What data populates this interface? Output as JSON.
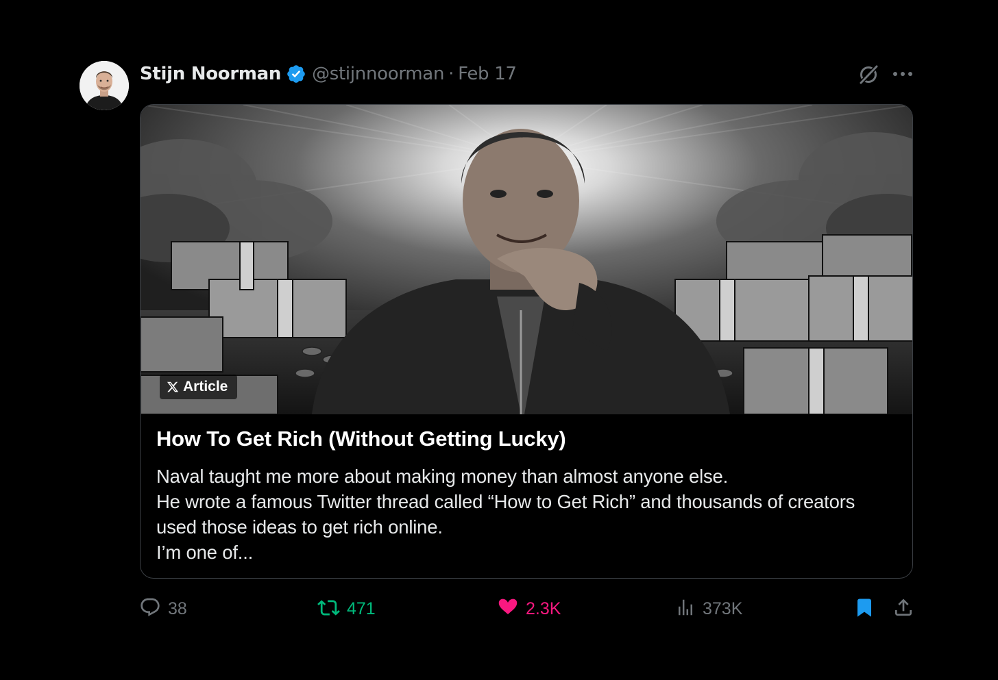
{
  "tweet": {
    "author": {
      "name": "Stijn Noorman",
      "handle": "@stijnnoorman",
      "verified": true,
      "verified_color": "#1d9bf0"
    },
    "separator": "·",
    "date": "Feb 17",
    "header_icons": [
      "grok-icon",
      "more-icon"
    ]
  },
  "article": {
    "badge_label": "Article",
    "title": "How To Get Rich (Without Getting Lucky)",
    "body_lines": [
      "Naval taught me more about making money than almost anyone else.",
      "He wrote a famous Twitter thread called “How to Get Rich” and thousands of creators",
      "used those ideas to get rich online.",
      "I’m one of..."
    ]
  },
  "actions": {
    "reply_count": "38",
    "retweet_count": "471",
    "like_count": "2.3K",
    "views_count": "373K",
    "colors": {
      "muted": "#71767b",
      "retweet": "#00ba7c",
      "like": "#f91880",
      "bookmark": "#1d9bf0"
    }
  }
}
